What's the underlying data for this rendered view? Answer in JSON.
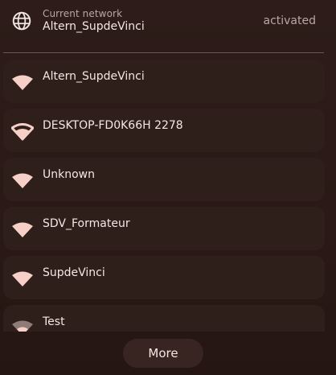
{
  "current_network": {
    "caption": "Current network",
    "name": "Altern_SupdeVinci",
    "status": "activated",
    "icon": "globe-icon"
  },
  "networks": [
    {
      "ssid": "Altern_SupdeVinci",
      "icon": "wifi-signal-full-icon"
    },
    {
      "ssid": "DESKTOP-FD0K66H 2278",
      "icon": "wifi-signal-good-icon"
    },
    {
      "ssid": "Unknown",
      "icon": "wifi-signal-full-icon"
    },
    {
      "ssid": "SDV_Formateur",
      "icon": "wifi-signal-full-icon"
    },
    {
      "ssid": "SupdeVinci",
      "icon": "wifi-signal-full-icon"
    },
    {
      "ssid": "Test",
      "icon": "wifi-signal-weak-icon"
    }
  ],
  "more_label": "More",
  "colors": {
    "background": "#2a1a17",
    "row": "#2f1f1b",
    "text": "#f3e7e4",
    "muted_text": "#b8a7a2",
    "wifi_icon": "#f6cfc7"
  }
}
